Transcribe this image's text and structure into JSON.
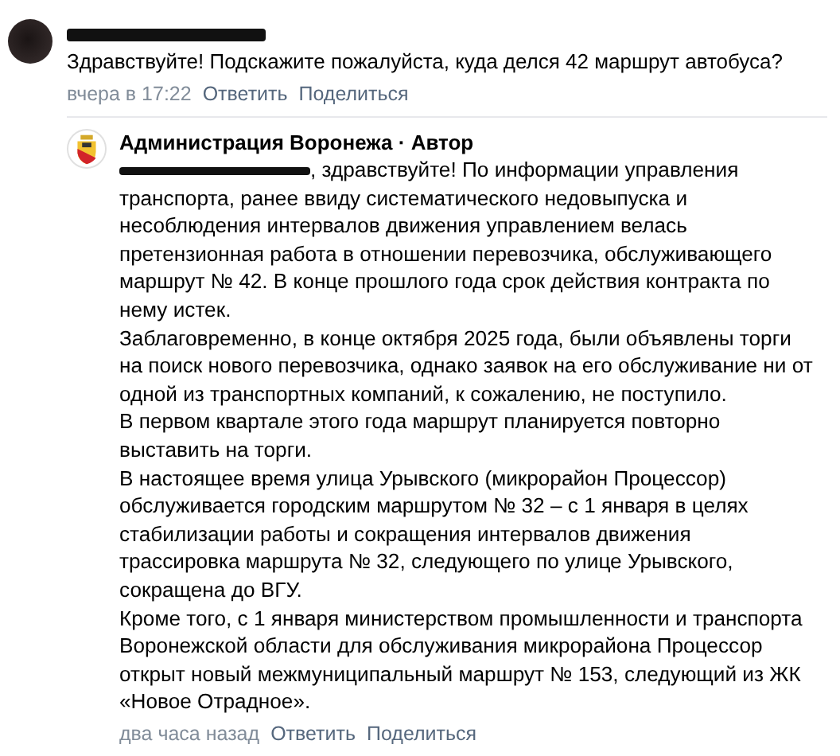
{
  "comments": [
    {
      "author_redacted": true,
      "text": "Здравствуйте! Подскажите пожалуйста, куда делся 42 маршрут автобуса?",
      "time": "вчера в 17:22",
      "actions": [
        "Ответить",
        "Поделиться"
      ],
      "replies": [
        {
          "author": "Администрация Воронежа · Автор",
          "mention_redacted": true,
          "paragraphs": [
            ", здравствуйте! По информации управления транспорта, ранее ввиду систематического недовыпуска и несоблюдения интервалов движения управлением велась претензионная работа в отношении перевозчика, обслуживающего маршрут № 42. В конце прошлого года срок действия контракта по нему истек.",
            "Заблаговременно, в конце октября 2025 года, были объявлены торги на поиск нового перевозчика, однако заявок на его обслуживание ни от одной из транспортных компаний, к сожалению, не поступило.",
            "В первом квартале этого года маршрут планируется повторно выставить на торги.",
            "В настоящее время улица Урывского (микрорайон Процессор) обслуживается городским маршрутом № 32 – с 1 января в целях стабилизации работы и сокращения интервалов движения трассировка маршрута № 32, следующего по улице Урывского, сокращена до ВГУ.",
            "Кроме того, с 1 января министерством промышленности и транспорта Воронежской области для обслуживания микрорайона Процессор открыт новый межмуниципальный маршрут № 153, следующий из ЖК «Новое Отрадное»."
          ],
          "time": "два часа назад",
          "actions": [
            "Ответить",
            "Поделиться"
          ]
        }
      ]
    }
  ]
}
